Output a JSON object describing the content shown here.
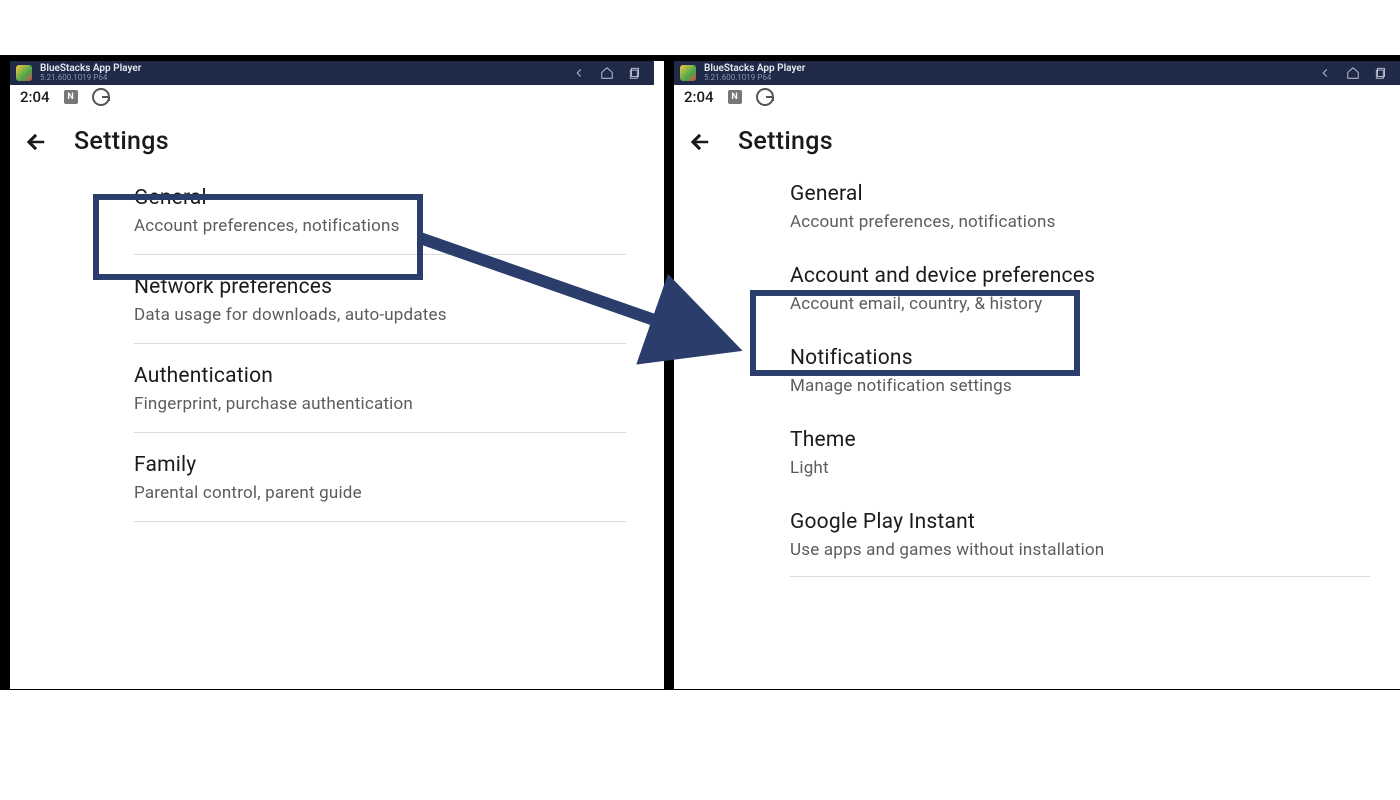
{
  "colors": {
    "highlight": "#2b3e6b",
    "titlebar": "#1e2a47"
  },
  "left": {
    "titlebar": {
      "title": "BlueStacks App Player",
      "sub": "5.21.600.1019  P64"
    },
    "time": "2:04",
    "header": "Settings",
    "items": [
      {
        "title": "General",
        "sub": "Account preferences, notifications"
      },
      {
        "title": "Network preferences",
        "sub": "Data usage for downloads, auto-updates"
      },
      {
        "title": "Authentication",
        "sub": "Fingerprint, purchase authentication"
      },
      {
        "title": "Family",
        "sub": "Parental control, parent guide"
      }
    ]
  },
  "right": {
    "titlebar": {
      "title": "BlueStacks App Player",
      "sub": "5.21.600.1019  P64"
    },
    "time": "2:04",
    "header": "Settings",
    "items": [
      {
        "title": "General",
        "sub": "Account preferences, notifications"
      },
      {
        "title": "Account and device preferences",
        "sub": "Account email, country, & history"
      },
      {
        "title": "Notifications",
        "sub": "Manage notification settings"
      },
      {
        "title": "Theme",
        "sub": "Light"
      },
      {
        "title": "Google Play Instant",
        "sub": "Use apps and games without installation"
      }
    ]
  },
  "highlight": {
    "left_item_index": 0,
    "right_item_index": 1
  }
}
